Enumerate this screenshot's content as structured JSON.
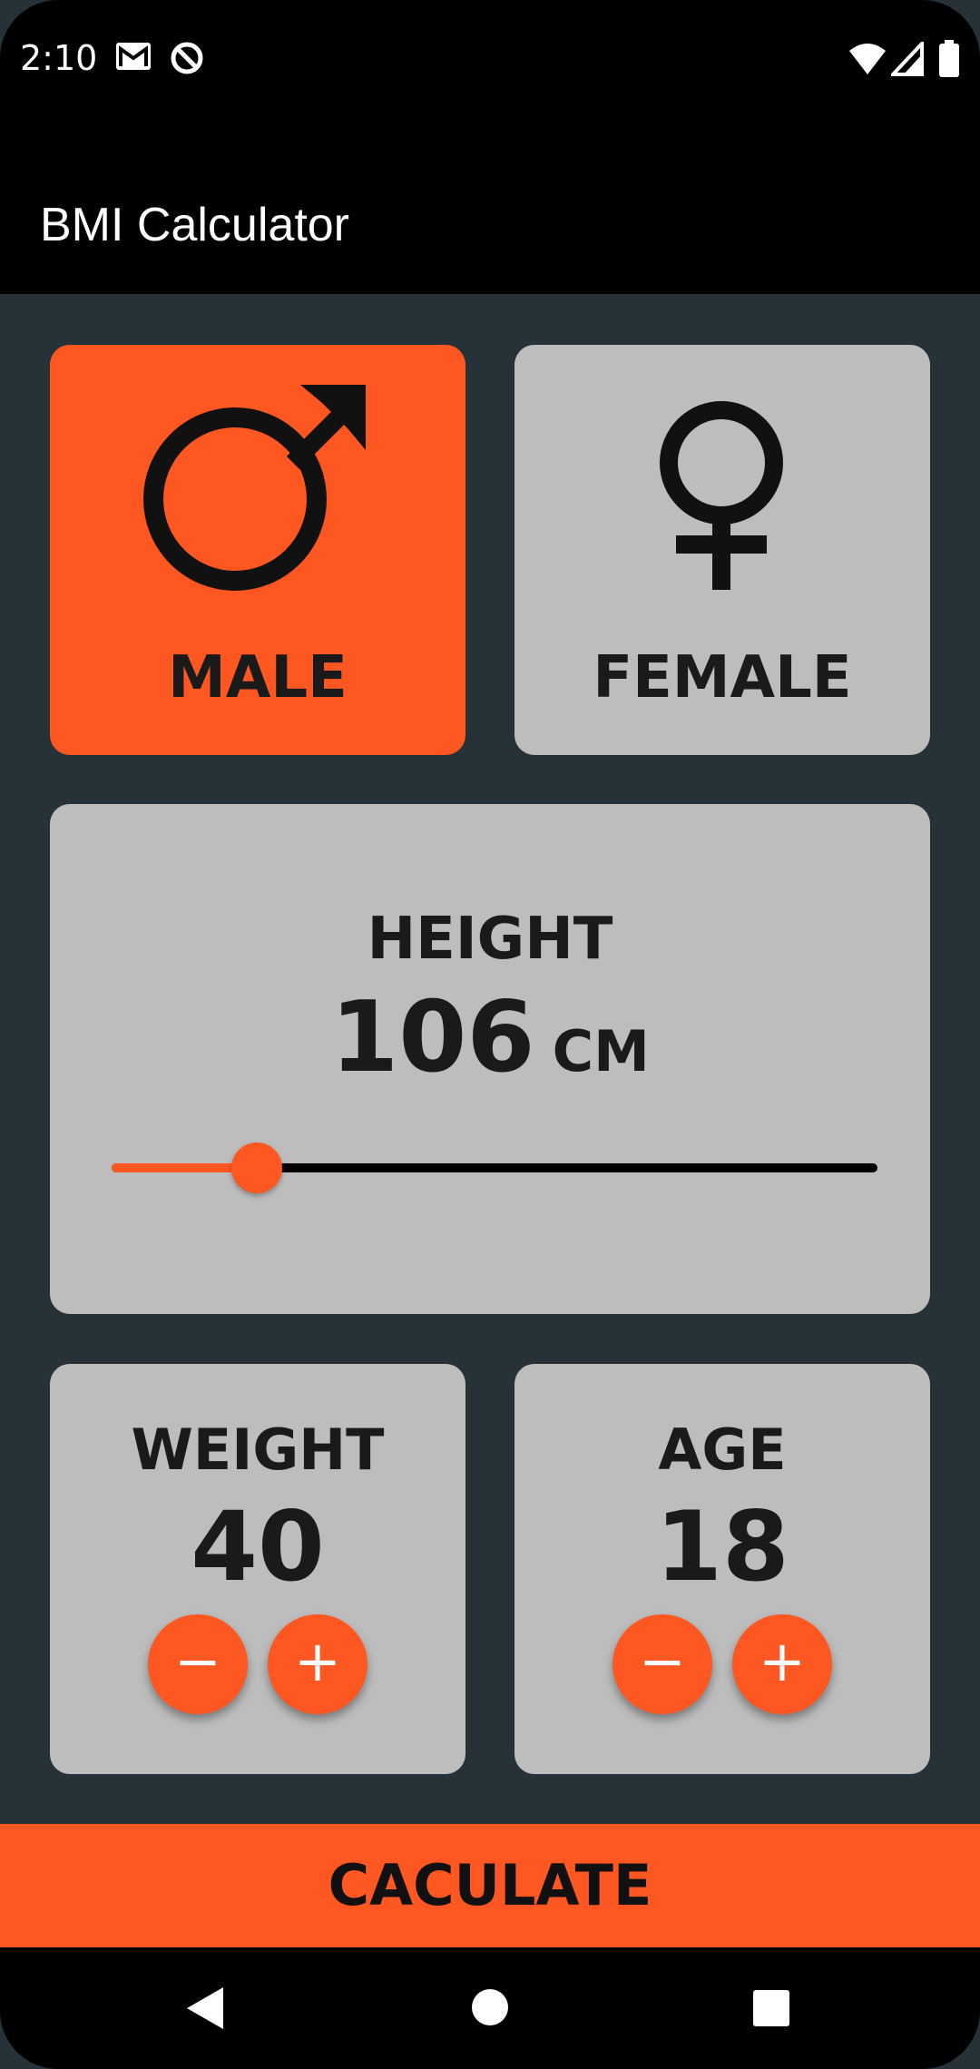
{
  "status_bar": {
    "time": "2:10",
    "icons": [
      "gmail-icon",
      "data-saver-icon",
      "wifi-icon",
      "signal-icon",
      "battery-icon"
    ]
  },
  "app": {
    "title": "BMI Calculator"
  },
  "gender": {
    "male_label": "MALE",
    "female_label": "FEMALE",
    "selected": "MALE"
  },
  "height": {
    "label": "HEIGHT",
    "value": "106",
    "unit": "CM",
    "slider_fraction": 0.19
  },
  "weight": {
    "label": "WEIGHT",
    "value": "40",
    "minus": "−",
    "plus": "+"
  },
  "age": {
    "label": "AGE",
    "value": "18",
    "minus": "−",
    "plus": "+"
  },
  "calculate_label": "CACULATE",
  "colors": {
    "accent": "#ff5722",
    "card": "#bdbdbd",
    "background": "#263238",
    "bar": "#000000"
  },
  "nav": {
    "icons": [
      "back-icon",
      "home-icon",
      "recents-icon"
    ]
  }
}
